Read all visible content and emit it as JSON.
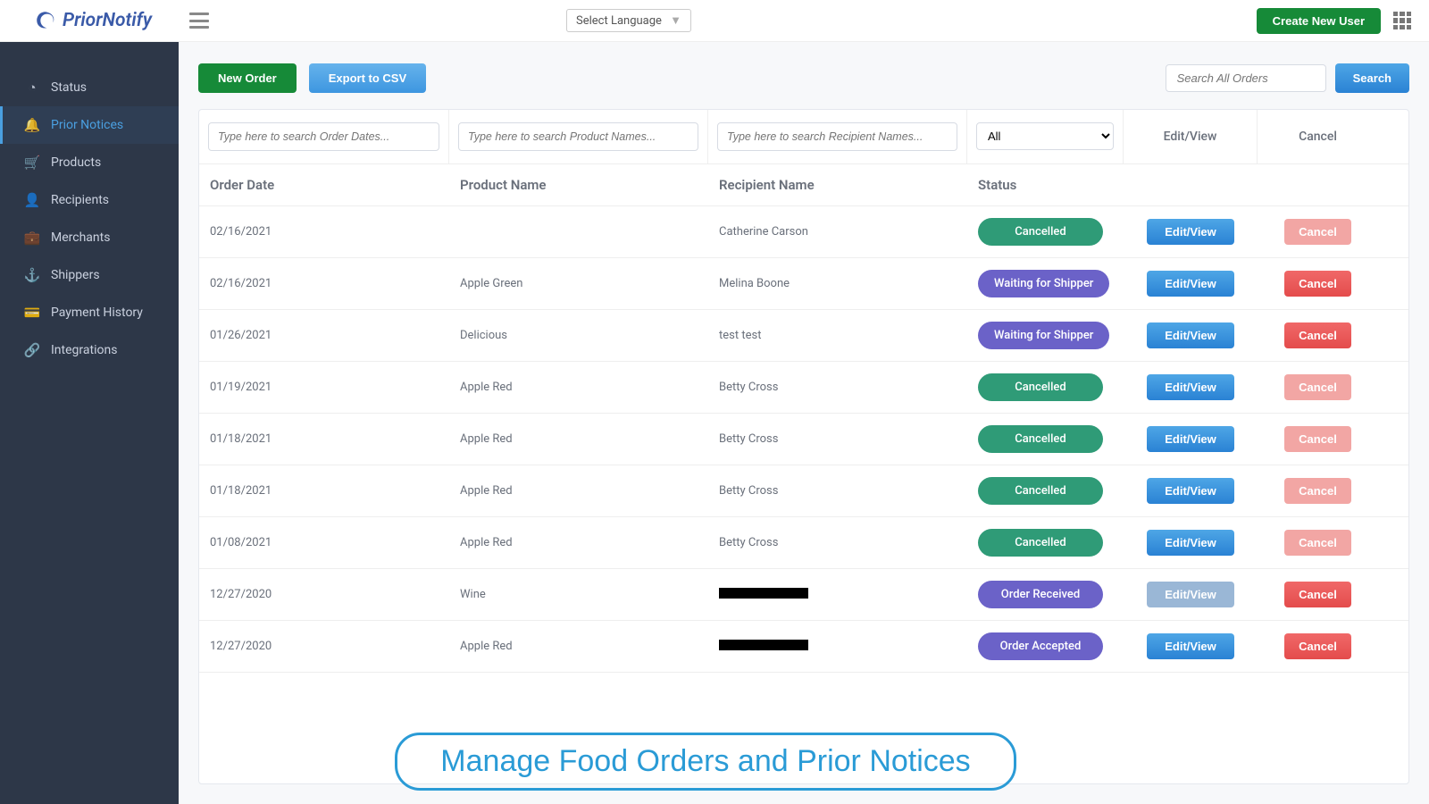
{
  "brand": {
    "name": "PriorNotify"
  },
  "topbar": {
    "language_label": "Select Language",
    "create_user": "Create New User"
  },
  "sidebar": {
    "items": [
      {
        "label": "Status",
        "icon": "status-icon"
      },
      {
        "label": "Prior Notices",
        "icon": "bell-icon",
        "active": true
      },
      {
        "label": "Products",
        "icon": "cart-icon"
      },
      {
        "label": "Recipients",
        "icon": "user-icon"
      },
      {
        "label": "Merchants",
        "icon": "briefcase-icon"
      },
      {
        "label": "Shippers",
        "icon": "anchor-icon"
      },
      {
        "label": "Payment History",
        "icon": "card-icon"
      },
      {
        "label": "Integrations",
        "icon": "integrations-icon"
      }
    ]
  },
  "actions": {
    "new_order": "New Order",
    "export_csv": "Export to CSV",
    "search_placeholder": "Search All Orders",
    "search": "Search"
  },
  "filters": {
    "date_placeholder": "Type here to search Order Dates...",
    "product_placeholder": "Type here to search Product Names...",
    "recipient_placeholder": "Type here to search Recipient Names...",
    "status_selected": "All"
  },
  "columns": {
    "date": "Order Date",
    "product": "Product Name",
    "recipient": "Recipient Name",
    "status": "Status",
    "editview": "Edit/View",
    "cancel": "Cancel"
  },
  "labels": {
    "editview": "Edit/View",
    "cancel": "Cancel"
  },
  "rows": [
    {
      "date": "02/16/2021",
      "product": "",
      "recipient": "Catherine Carson",
      "status": "Cancelled",
      "pill": "pill-cancelled",
      "cancel_soft": true,
      "edit_disabled": false
    },
    {
      "date": "02/16/2021",
      "product": "Apple Green",
      "recipient": "Melina Boone",
      "status": "Waiting for Shipper",
      "pill": "pill-waiting",
      "cancel_soft": false,
      "edit_disabled": false
    },
    {
      "date": "01/26/2021",
      "product": "Delicious",
      "recipient": "test test",
      "status": "Waiting for Shipper",
      "pill": "pill-waiting",
      "cancel_soft": false,
      "edit_disabled": false
    },
    {
      "date": "01/19/2021",
      "product": "Apple Red",
      "recipient": "Betty Cross",
      "status": "Cancelled",
      "pill": "pill-cancelled",
      "cancel_soft": true,
      "edit_disabled": false
    },
    {
      "date": "01/18/2021",
      "product": "Apple Red",
      "recipient": "Betty Cross",
      "status": "Cancelled",
      "pill": "pill-cancelled",
      "cancel_soft": true,
      "edit_disabled": false
    },
    {
      "date": "01/18/2021",
      "product": "Apple Red",
      "recipient": "Betty Cross",
      "status": "Cancelled",
      "pill": "pill-cancelled",
      "cancel_soft": true,
      "edit_disabled": false
    },
    {
      "date": "01/08/2021",
      "product": "Apple Red",
      "recipient": "Betty Cross",
      "status": "Cancelled",
      "pill": "pill-cancelled",
      "cancel_soft": true,
      "edit_disabled": false
    },
    {
      "date": "12/27/2020",
      "product": "Wine",
      "recipient": "[REDACTED]",
      "status": "Order Received",
      "pill": "pill-received",
      "cancel_soft": false,
      "edit_disabled": true
    },
    {
      "date": "12/27/2020",
      "product": "Apple Red",
      "recipient": "[REDACTED]",
      "status": "Order Accepted",
      "pill": "pill-accepted",
      "cancel_soft": false,
      "edit_disabled": false
    }
  ],
  "caption": "Manage Food Orders and Prior Notices"
}
